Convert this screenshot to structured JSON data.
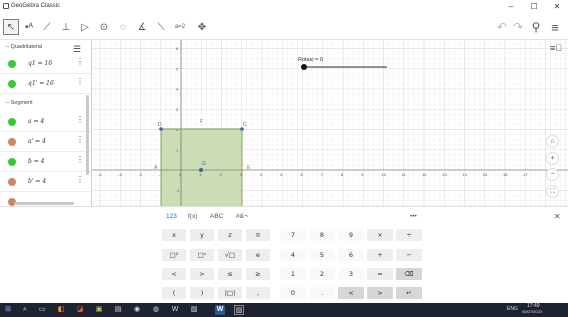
{
  "window": {
    "title": "GeoGebra Classic",
    "minimize": "–",
    "maximize": "☐",
    "close": "✕"
  },
  "toolbar": {
    "tools": [
      {
        "name": "move-tool",
        "glyph": "↖"
      },
      {
        "name": "point-tool",
        "glyph": "•ᴬ"
      },
      {
        "name": "line-tool",
        "glyph": "⟋"
      },
      {
        "name": "perpendicular-tool",
        "glyph": "⊥"
      },
      {
        "name": "polygon-tool",
        "glyph": "▷"
      },
      {
        "name": "circle-tool",
        "glyph": "⊙"
      },
      {
        "name": "circle-three-points-tool",
        "glyph": "◌"
      },
      {
        "name": "angle-tool",
        "glyph": "∡"
      },
      {
        "name": "reflect-tool",
        "glyph": "⟍"
      },
      {
        "name": "slider-tool",
        "glyph": "a=2"
      },
      {
        "name": "move-graphics-tool",
        "glyph": "✥"
      }
    ],
    "undo": "↶",
    "redo": "↷",
    "search": "⚲",
    "menu": "≡"
  },
  "algebra": {
    "groups": [
      "Quadrilateral",
      "Segment"
    ],
    "rows": [
      {
        "expr": "q1 = 16",
        "color": "#33cc33"
      },
      {
        "expr": "q1' = 16",
        "color": "#33cc33"
      },
      {
        "expr": "a = 4",
        "color": "#33cc33"
      },
      {
        "expr": "a' = 4",
        "color": "#cc8866"
      },
      {
        "expr": "b = 4",
        "color": "#33cc33"
      },
      {
        "expr": "b' = 4",
        "color": "#cc8866"
      }
    ],
    "style_toggle": "☰",
    "kebab": "⋮"
  },
  "graphics": {
    "x_ticks": [
      "-4",
      "-3",
      "-2",
      "-1",
      "0",
      "1",
      "2",
      "3",
      "4",
      "5",
      "6",
      "7",
      "8",
      "9",
      "10",
      "11",
      "12",
      "13",
      "14",
      "15",
      "16",
      "17"
    ],
    "y_ticks": [
      "9",
      "8",
      "7",
      "6",
      "5",
      "4",
      "3",
      "2",
      "1",
      "-1",
      "-2"
    ],
    "point_labels": {
      "A": "A",
      "B": "B",
      "C": "C",
      "D": "D",
      "E": "E",
      "F": "F",
      "G": "G"
    },
    "slider_label": "Rotasi = 0",
    "slider_value": 0,
    "square_fill": "#c4d7a9",
    "square_stroke": "#7c9a4c",
    "buttons": {
      "home": "⌂",
      "zoom_in": "+",
      "zoom_out": "−",
      "fullscreen": "⛶",
      "style": "≡⃞"
    }
  },
  "keyboard": {
    "tabs": [
      "123",
      "f(x)",
      "ABC",
      "#&¬"
    ],
    "more": "•••",
    "close": "✕",
    "left": [
      [
        "x",
        "y",
        "z",
        "π"
      ],
      [
        "□²",
        "□ⁿ",
        "√□",
        "e"
      ],
      [
        "<",
        ">",
        "≤",
        "≥"
      ],
      [
        "(",
        ")",
        "|□|",
        ","
      ]
    ],
    "right": [
      [
        "7",
        "8",
        "9",
        "×",
        "÷"
      ],
      [
        "4",
        "5",
        "6",
        "+",
        "−"
      ],
      [
        "1",
        "2",
        "3",
        "=",
        "⌫"
      ],
      [
        "0",
        ".",
        "<",
        ">",
        "↵"
      ]
    ]
  },
  "taskbar": {
    "start": "⊞",
    "icons": [
      "⌕",
      "▭",
      "◧",
      "◪",
      "▣",
      "▤",
      "◉",
      "◍",
      "W",
      "▨"
    ],
    "tray": {
      "lang": "ENG",
      "time": "17:49",
      "date": "06/07/2023"
    }
  }
}
